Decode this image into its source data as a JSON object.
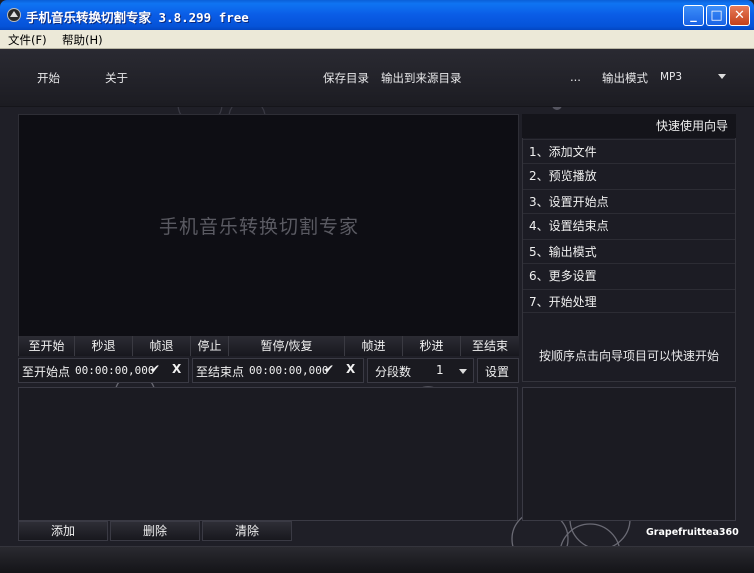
{
  "window": {
    "title": "手机音乐转换切割专家 3.8.299 free",
    "minimize_label": "_",
    "maximize_label": "□",
    "close_label": "✕"
  },
  "menu": [
    {
      "label": "文件(F)"
    },
    {
      "label": "帮助(H)"
    }
  ],
  "toolbar": {
    "start": "开始",
    "about": "关于",
    "save_dir": "保存目录",
    "output_to_source": "输出到来源目录",
    "ellipsis": "...",
    "output_mode_label": "输出模式",
    "output_mode_value": "MP3"
  },
  "player": {
    "watermark": "手机音乐转换切割专家",
    "controls": [
      "至开始",
      "秒退",
      "帧退",
      "停止",
      "暂停/恢复",
      "帧进",
      "秒进",
      "至结束"
    ]
  },
  "cut": {
    "start_label": "至开始点",
    "start_time": "00:00:00,000",
    "end_label": "至结束点",
    "end_time": "00:00:00,000",
    "confirm_mark": "✔",
    "clear_mark": "X",
    "segments_label": "分段数",
    "segments_value": "1",
    "settings_label": "设置"
  },
  "file_buttons": {
    "add": "添加",
    "delete": "删除",
    "clear": "清除"
  },
  "guide": {
    "title": "快速使用向导",
    "items": [
      "1、添加文件",
      "2、预览播放",
      "3、设置开始点",
      "4、设置结束点",
      "5、输出模式",
      "6、更多设置",
      "7、开始处理"
    ],
    "hint": "按顺序点击向导项目可以快速开始"
  },
  "brand": "Grapefruittea360",
  "colors": {
    "titlebar": "#0a5ce6",
    "app_bg": "#1f1f27",
    "text": "#f0f0f0"
  }
}
